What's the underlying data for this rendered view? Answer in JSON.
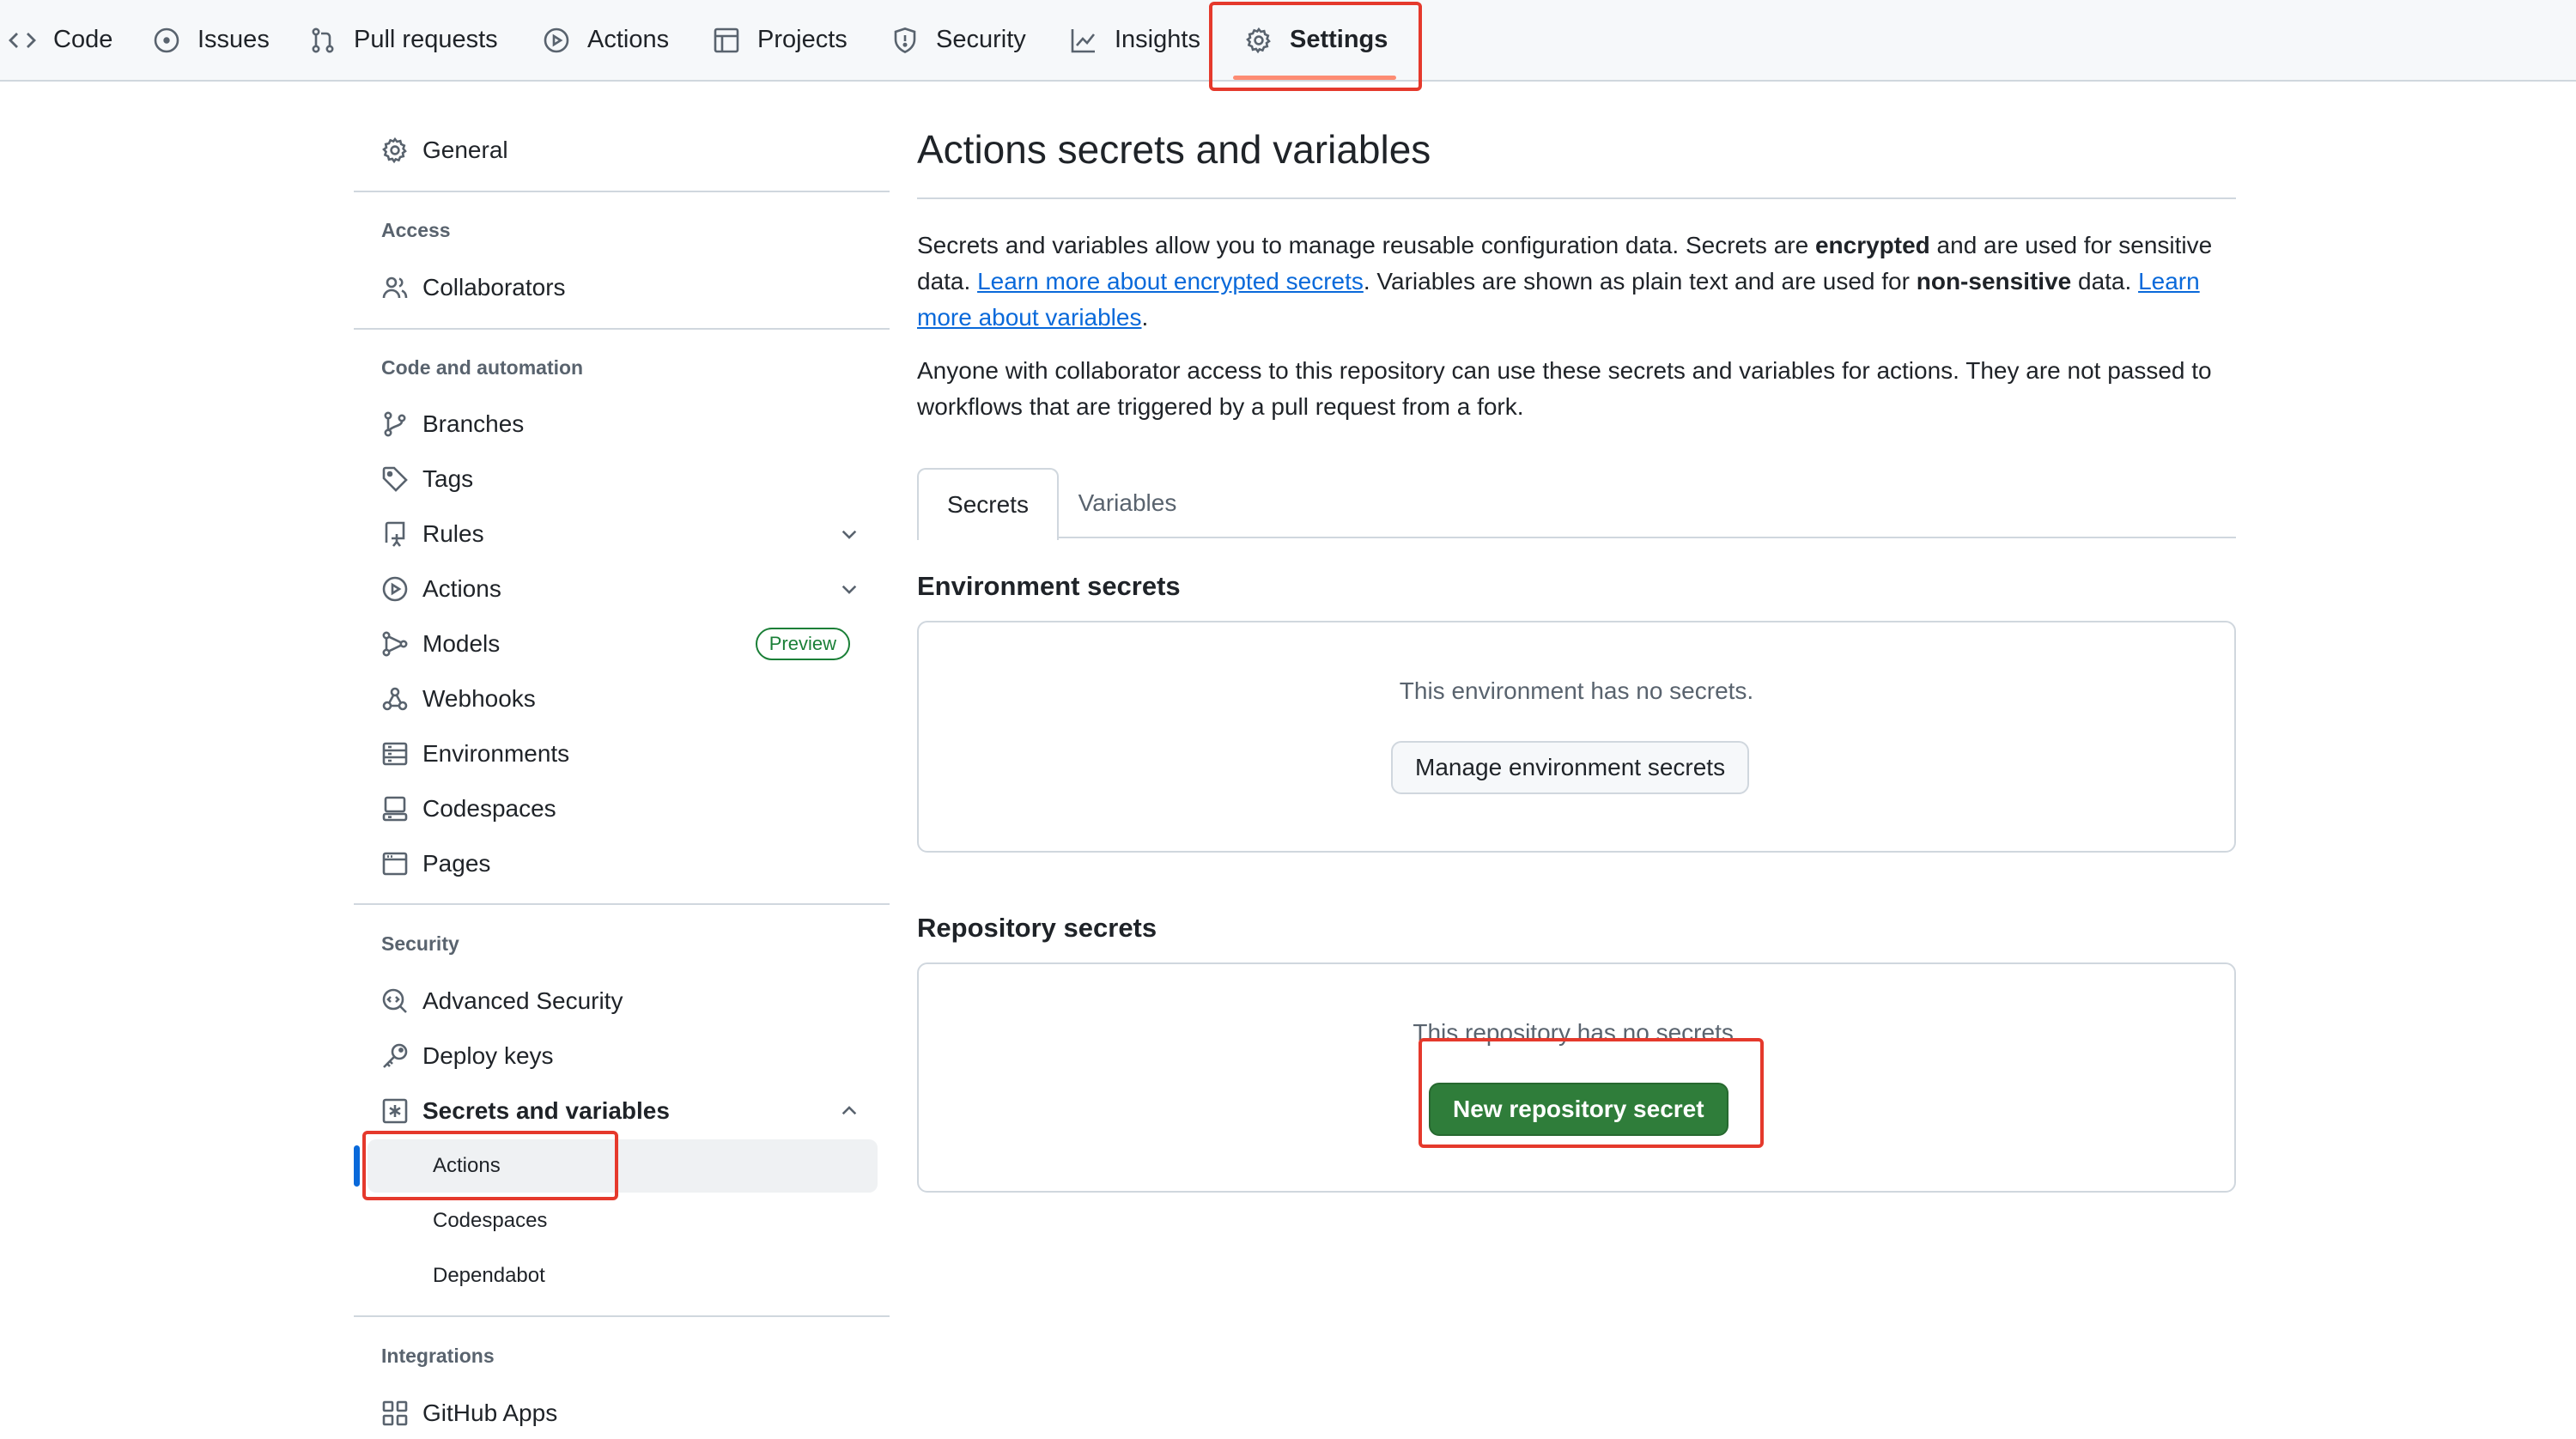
{
  "nav": {
    "tabs": [
      {
        "label": "Code",
        "icon": "code-icon"
      },
      {
        "label": "Issues",
        "icon": "issue-opened-icon"
      },
      {
        "label": "Pull requests",
        "icon": "git-pull-request-icon"
      },
      {
        "label": "Actions",
        "icon": "play-icon"
      },
      {
        "label": "Projects",
        "icon": "table-icon"
      },
      {
        "label": "Security",
        "icon": "shield-icon"
      },
      {
        "label": "Insights",
        "icon": "graph-icon"
      },
      {
        "label": "Settings",
        "icon": "gear-icon",
        "active": true
      }
    ]
  },
  "sidebar": {
    "general": "General",
    "access_heading": "Access",
    "collaborators": "Collaborators",
    "code_automation_heading": "Code and automation",
    "branches": "Branches",
    "tags": "Tags",
    "rules": "Rules",
    "actions": "Actions",
    "models": "Models",
    "models_badge": "Preview",
    "webhooks": "Webhooks",
    "environments": "Environments",
    "codespaces": "Codespaces",
    "pages": "Pages",
    "security_heading": "Security",
    "advanced_security": "Advanced Security",
    "deploy_keys": "Deploy keys",
    "secrets_and_variables": "Secrets and variables",
    "sub_actions": "Actions",
    "sub_codespaces": "Codespaces",
    "sub_dependabot": "Dependabot",
    "integrations_heading": "Integrations",
    "github_apps": "GitHub Apps"
  },
  "main": {
    "title": "Actions secrets and variables",
    "intro": {
      "t1": "Secrets and variables allow you to manage reusable configuration data. Secrets are ",
      "b1": "encrypted",
      "t2": " and are used for sensitive data. ",
      "link1": "Learn more about encrypted secrets",
      "t3": ". Variables are shown as plain text and are used for ",
      "b2": "non-sensitive",
      "t4": " data. ",
      "link2": "Learn more about variables",
      "t5": "."
    },
    "access_note": "Anyone with collaborator access to this repository can use these secrets and variables for actions. They are not passed to workflows that are triggered by a pull request from a fork.",
    "tabs": {
      "secrets": "Secrets",
      "variables": "Variables"
    },
    "env_secrets": {
      "title": "Environment secrets",
      "empty": "This environment has no secrets.",
      "button": "Manage environment secrets"
    },
    "repo_secrets": {
      "title": "Repository secrets",
      "empty": "This repository has no secrets.",
      "button": "New repository secret"
    }
  },
  "colors": {
    "accent": "#0969da",
    "primary_button": "#2f7d3a",
    "highlight_box": "#e5392c",
    "active_tab_underline": "#fd8c73"
  }
}
